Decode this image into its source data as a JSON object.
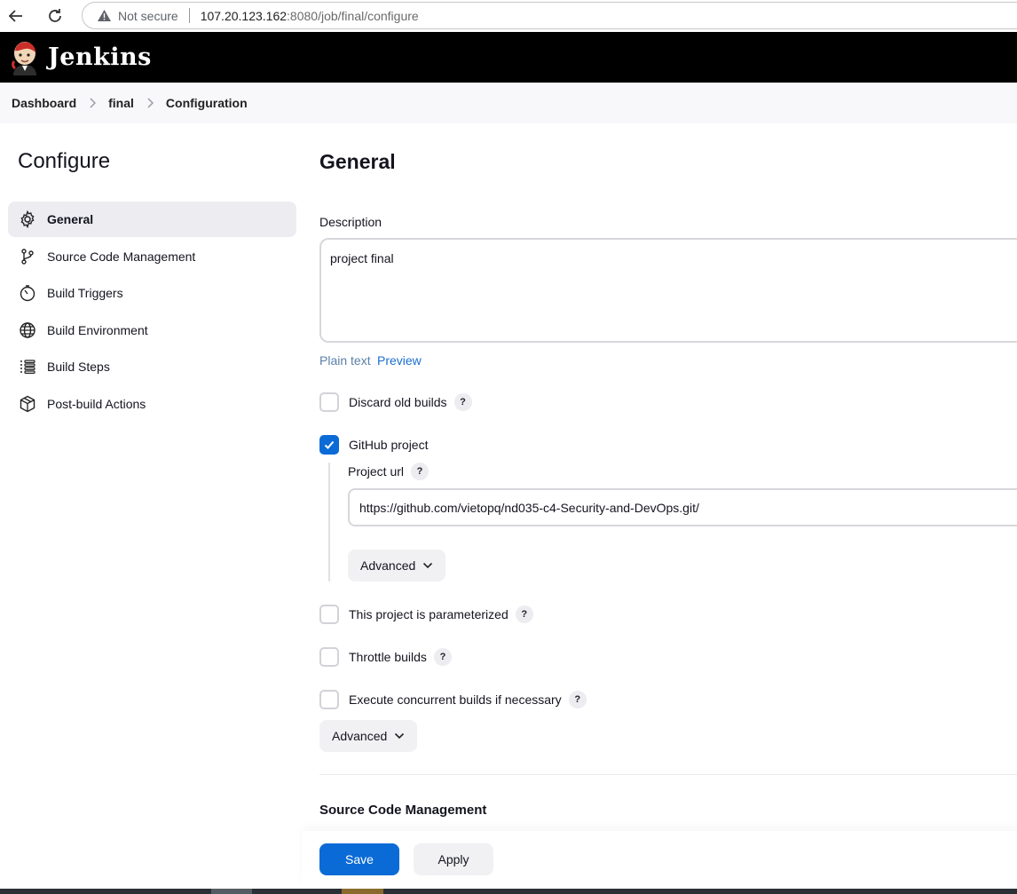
{
  "browser": {
    "security_label": "Not secure",
    "url_host": "107.20.123.162",
    "url_rest": ":8080/job/final/configure"
  },
  "header": {
    "title": "Jenkins"
  },
  "breadcrumb": {
    "items": [
      "Dashboard",
      "final",
      "Configuration"
    ]
  },
  "sidebar": {
    "title": "Configure",
    "items": [
      {
        "label": "General",
        "icon": "gear-icon",
        "active": true
      },
      {
        "label": "Source Code Management",
        "icon": "git-branch-icon"
      },
      {
        "label": "Build Triggers",
        "icon": "timer-icon"
      },
      {
        "label": "Build Environment",
        "icon": "globe-icon"
      },
      {
        "label": "Build Steps",
        "icon": "list-icon"
      },
      {
        "label": "Post-build Actions",
        "icon": "package-icon"
      }
    ]
  },
  "main": {
    "title": "General",
    "description_label": "Description",
    "description_value": "project final",
    "plain_text": "Plain text",
    "preview": "Preview",
    "options": [
      {
        "label": "Discard old builds",
        "checked": false
      },
      {
        "label": "GitHub project",
        "checked": true
      },
      {
        "label": "This project is parameterized",
        "checked": false
      },
      {
        "label": "Throttle builds",
        "checked": false
      },
      {
        "label": "Execute concurrent builds if necessary",
        "checked": false
      }
    ],
    "project_url_label": "Project url",
    "project_url_value": "https://github.com/vietopq/nd035-c4-Security-and-DevOps.git/",
    "advanced_label": "Advanced",
    "next_section": "Source Code Management"
  },
  "actions": {
    "save": "Save",
    "apply": "Apply"
  },
  "colors": {
    "accent": "#0b6bd6",
    "header_bg": "#000000"
  }
}
